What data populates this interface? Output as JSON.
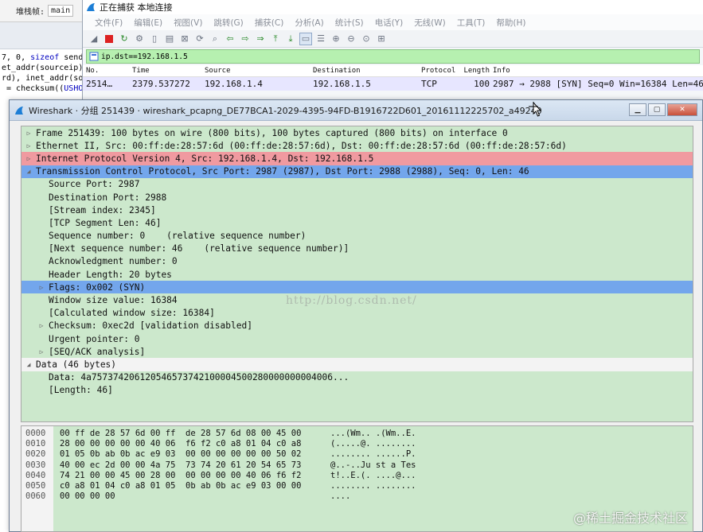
{
  "ide": {
    "frame_label": "堆栈帧:",
    "frame_value": "main",
    "code_lines": [
      {
        "pre": "7, 0, ",
        "kw": "sizeof",
        "post": " sendb"
      },
      {
        "pre": "et_addr(sourceip),",
        "kw": "",
        "post": ""
      },
      {
        "pre": "rd), inet_addr(sou",
        "kw": "",
        "post": ""
      },
      {
        "pre": " = checksum((",
        "kw": "USHOR",
        "post": ""
      }
    ]
  },
  "main_window": {
    "title": "正在捕获 本地连接",
    "menu": [
      "文件(F)",
      "编辑(E)",
      "视图(V)",
      "跳转(G)",
      "捕获(C)",
      "分析(A)",
      "统计(S)",
      "电话(Y)",
      "无线(W)",
      "工具(T)",
      "帮助(H)"
    ],
    "filter": "ip.dst==192.168.1.5",
    "columns": [
      "No.",
      "Time",
      "Source",
      "Destination",
      "Protocol",
      "Length",
      "Info"
    ],
    "row": {
      "no": "2514…",
      "time": "2379.537272",
      "source": "192.168.1.4",
      "destination": "192.168.1.5",
      "protocol": "TCP",
      "length": "100",
      "info": "2987 → 2988 [SYN] Seq=0 Win=16384 Len=46"
    }
  },
  "packet_window": {
    "title": "Wireshark · 分组 251439 · wireshark_pcapng_DE77BCA1-2029-4395-94FD-B1916722D601_20161112225702_a49240",
    "tree": [
      {
        "arrow": "▷",
        "indent": 0,
        "style": "",
        "text": "Frame 251439: 100 bytes on wire (800 bits), 100 bytes captured (800 bits) on interface 0"
      },
      {
        "arrow": "▷",
        "indent": 0,
        "style": "",
        "text": "Ethernet II, Src: 00:ff:de:28:57:6d (00:ff:de:28:57:6d), Dst: 00:ff:de:28:57:6d (00:ff:de:28:57:6d)"
      },
      {
        "arrow": "▷",
        "indent": 0,
        "style": "ip",
        "text": "Internet Protocol Version 4, Src: 192.168.1.4, Dst: 192.168.1.5"
      },
      {
        "arrow": "◢",
        "indent": 0,
        "style": "tcp",
        "text": "Transmission Control Protocol, Src Port: 2987 (2987), Dst Port: 2988 (2988), Seq: 0, Len: 46"
      },
      {
        "arrow": "",
        "indent": 1,
        "style": "",
        "text": "Source Port: 2987"
      },
      {
        "arrow": "",
        "indent": 1,
        "style": "",
        "text": "Destination Port: 2988"
      },
      {
        "arrow": "",
        "indent": 1,
        "style": "",
        "text": "[Stream index: 2345]"
      },
      {
        "arrow": "",
        "indent": 1,
        "style": "",
        "text": "[TCP Segment Len: 46]"
      },
      {
        "arrow": "",
        "indent": 1,
        "style": "",
        "text": "Sequence number: 0    (relative sequence number)"
      },
      {
        "arrow": "",
        "indent": 1,
        "style": "",
        "text": "[Next sequence number: 46    (relative sequence number)]"
      },
      {
        "arrow": "",
        "indent": 1,
        "style": "",
        "text": "Acknowledgment number: 0"
      },
      {
        "arrow": "",
        "indent": 1,
        "style": "",
        "text": "Header Length: 20 bytes"
      },
      {
        "arrow": "▷",
        "indent": 1,
        "style": "flags",
        "text": "Flags: 0x002 (SYN)"
      },
      {
        "arrow": "",
        "indent": 1,
        "style": "",
        "text": "Window size value: 16384"
      },
      {
        "arrow": "",
        "indent": 1,
        "style": "",
        "text": "[Calculated window size: 16384]"
      },
      {
        "arrow": "▷",
        "indent": 1,
        "style": "",
        "text": "Checksum: 0xec2d [validation disabled]"
      },
      {
        "arrow": "",
        "indent": 1,
        "style": "",
        "text": "Urgent pointer: 0"
      },
      {
        "arrow": "▷",
        "indent": 1,
        "style": "",
        "text": "[SEQ/ACK analysis]"
      },
      {
        "arrow": "◢",
        "indent": 0,
        "style": "data",
        "text": "Data (46 bytes)"
      },
      {
        "arrow": "",
        "indent": 1,
        "style": "",
        "text": "Data: 4a757374206120546573742100004500280000000004006..."
      },
      {
        "arrow": "",
        "indent": 1,
        "style": "",
        "text": "[Length: 46]"
      }
    ],
    "watermark": "http://blog.csdn.net/",
    "hex": [
      {
        "offset": "0000",
        "bytes": "00 ff de 28 57 6d 00 ff  de 28 57 6d 08 00 45 00",
        "ascii": "...(Wm.. .(Wm..E."
      },
      {
        "offset": "0010",
        "bytes": "28 00 00 00 00 00 40 06  f6 f2 c0 a8 01 04 c0 a8",
        "ascii": "(.....@. ........"
      },
      {
        "offset": "0020",
        "bytes": "01 05 0b ab 0b ac e9 03  00 00 00 00 00 00 50 02",
        "ascii": "........ ......P."
      },
      {
        "offset": "0030",
        "bytes": "40 00 ec 2d 00 00 4a 75  73 74 20 61 20 54 65 73",
        "ascii": "@..-..Ju st a Tes"
      },
      {
        "offset": "0040",
        "bytes": "74 21 00 00 45 00 28 00  00 00 00 00 40 06 f6 f2",
        "ascii": "t!..E.(. ....@..."
      },
      {
        "offset": "0050",
        "bytes": "c0 a8 01 04 c0 a8 01 05  0b ab 0b ac e9 03 00 00",
        "ascii": "........ ........"
      },
      {
        "offset": "0060",
        "bytes": "00 00 00 00",
        "ascii": "...."
      }
    ],
    "corner_watermark": "@稀土掘金技术社区"
  }
}
